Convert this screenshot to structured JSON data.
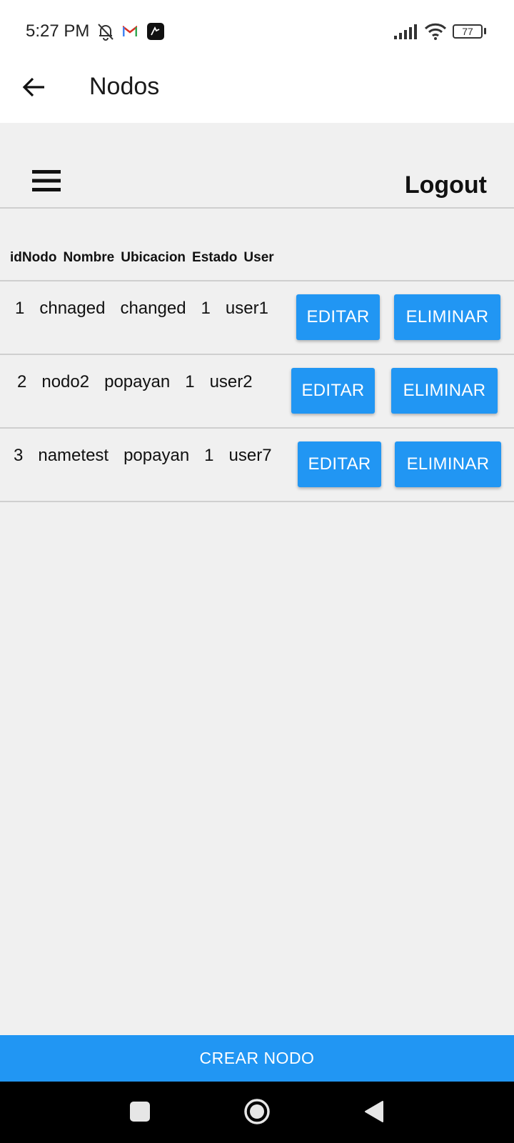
{
  "status_bar": {
    "time": "5:27 PM",
    "battery": "77",
    "icons": [
      "muted-bell-icon",
      "gmail-icon",
      "app-icon",
      "signal-icon",
      "wifi-icon",
      "battery-icon"
    ]
  },
  "app_bar": {
    "title": "Nodos",
    "back_icon": "arrow-left-icon"
  },
  "toolbar": {
    "menu_icon": "hamburger-menu-icon",
    "logout_label": "Logout"
  },
  "table": {
    "headers": [
      "idNodo",
      "Nombre",
      "Ubicacion",
      "Estado",
      "User"
    ],
    "rows": [
      {
        "id": "1",
        "nombre": "chnaged",
        "ubicacion": "changed",
        "estado": "1",
        "user": "user1",
        "edit_label": "EDITAR",
        "delete_label": "ELIMINAR"
      },
      {
        "id": "2",
        "nombre": "nodo2",
        "ubicacion": "popayan",
        "estado": "1",
        "user": "user2",
        "edit_label": "EDITAR",
        "delete_label": "ELIMINAR"
      },
      {
        "id": "3",
        "nombre": "nametest",
        "ubicacion": "popayan",
        "estado": "1",
        "user": "user7",
        "edit_label": "EDITAR",
        "delete_label": "ELIMINAR"
      }
    ]
  },
  "create_button_label": "CREAR NODO",
  "nav_bar": {
    "icons": [
      "recents-square-icon",
      "home-circle-icon",
      "back-triangle-icon"
    ]
  },
  "colors": {
    "primary": "#2196f3",
    "background": "#f0f0f0",
    "surface": "#ffffff",
    "navbar": "#000000"
  }
}
